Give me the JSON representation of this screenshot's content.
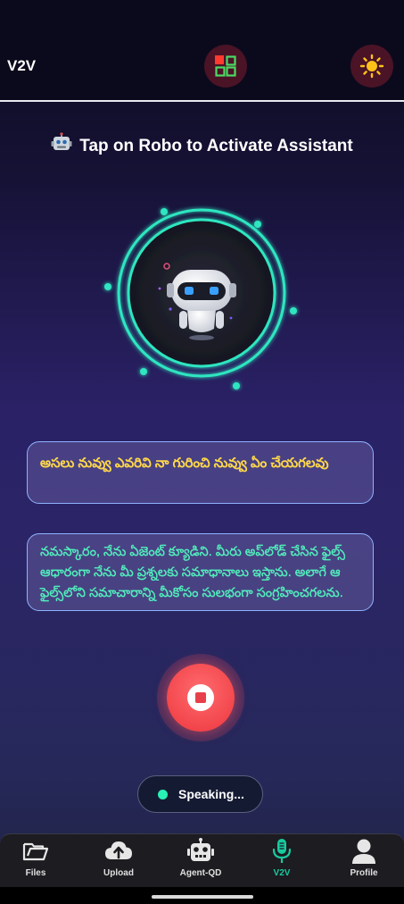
{
  "app": {
    "title": "V2V"
  },
  "header": {
    "headline": "Tap on Robo to Activate Assistant"
  },
  "conversation": {
    "user_message": "అసలు నువ్వు ఎవరివి నా గురించి నువ్వు ఏం చేయగలవు",
    "assistant_message": "నమస్కారం, నేను ఏజెంట్ క్యూడిని. మీరు అప్‌లోడ్ చేసిన ఫైల్స్ ఆధారంగా నేను మీ ప్రశ్నలకు సమాధానాలు ఇస్తాను. అలాగే ఆ ఫైల్స్‌లోని సమాచారాన్ని మీకోసం సులభంగా సంగ్రహించగలను."
  },
  "status": {
    "label": "Speaking..."
  },
  "nav": {
    "items": [
      {
        "label": "Files",
        "icon": "folder-icon",
        "active": false
      },
      {
        "label": "Upload",
        "icon": "cloud-upload-icon",
        "active": false
      },
      {
        "label": "Agent-QD",
        "icon": "robot-icon",
        "active": false
      },
      {
        "label": "V2V",
        "icon": "microphone-icon",
        "active": true
      },
      {
        "label": "Profile",
        "icon": "person-icon",
        "active": false
      }
    ]
  },
  "colors": {
    "accent": "#19c9a0",
    "user_text": "#ffd84a",
    "assistant_text": "#52f0bd",
    "stop_button": "#f2464c",
    "ring": "#2ee6c0"
  }
}
